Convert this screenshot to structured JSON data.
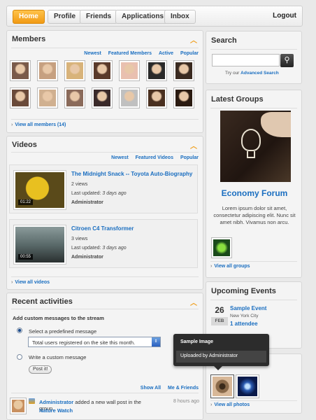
{
  "nav": {
    "tabs": [
      "Home",
      "Profile",
      "Friends",
      "Applications",
      "Inbox"
    ],
    "logout": "Logout"
  },
  "members": {
    "title": "Members",
    "filters": [
      "Newest",
      "Featured Members",
      "Active",
      "Popular"
    ],
    "view_all": "View all members (14)",
    "avatar_colors": [
      "#7a5a4a",
      "#c6a080",
      "#d8b37a",
      "#5a3a2a",
      "#e9c0b0",
      "#2a2a2a",
      "#3a2a20",
      "#6a4a3a",
      "#d0b090",
      "#8a6a5a",
      "#3a2a2a",
      "#c0c0c0",
      "#4a3020",
      "#2a1a10"
    ]
  },
  "videos": {
    "title": "Videos",
    "filters": [
      "Newest",
      "Featured Videos",
      "Popular"
    ],
    "items": [
      {
        "title": "The Midnight Snack -- Toyota Auto-Biography",
        "views": "2 views",
        "updated_label": "Last updated:",
        "updated": "3 days ago",
        "author": "Administrator",
        "duration": "01:22"
      },
      {
        "title": "Citroen C4 Transformer",
        "views": "3 views",
        "updated_label": "Last updated:",
        "updated": "3 days ago",
        "author": "Administrator",
        "duration": "00:55"
      }
    ],
    "view_all": "View all videos"
  },
  "activities": {
    "title": "Recent activities",
    "form_title": "Add custom messages to the stream",
    "option_predefined": "Select a predefined message",
    "select_value": "Total users registered on the site this month.",
    "option_custom": "Write a custom message",
    "post_button": "Post it!",
    "filters": [
      "Show All",
      "Me & Friends"
    ],
    "entry": {
      "user": "Administrator",
      "text": "added a new wall post in the group,",
      "group": "Nature Watch",
      "time": "8 hours ago"
    }
  },
  "search": {
    "title": "Search",
    "hint_prefix": "Try our",
    "hint_link": "Advanced Search"
  },
  "latest_groups": {
    "title": "Latest Groups",
    "group_name": "Economy Forum",
    "description": "Lorem ipsum dolor sit amet, consectetur adipiscing elit. Nunc sit amet nibh. Vivamus non arcu.",
    "view_all": "View all groups"
  },
  "events": {
    "title": "Upcoming Events",
    "day": "26",
    "month": "FEB",
    "name": "Sample Event",
    "location": "New York City",
    "attendees": "1 attendee"
  },
  "photos": {
    "view_all": "View all photos",
    "tooltip_title": "Sample Image",
    "tooltip_text": "Uploaded by Administrator"
  },
  "colors": {
    "accent": "#f19a14",
    "link": "#1a6ec0",
    "brand_blue": "#1a6ec0"
  }
}
